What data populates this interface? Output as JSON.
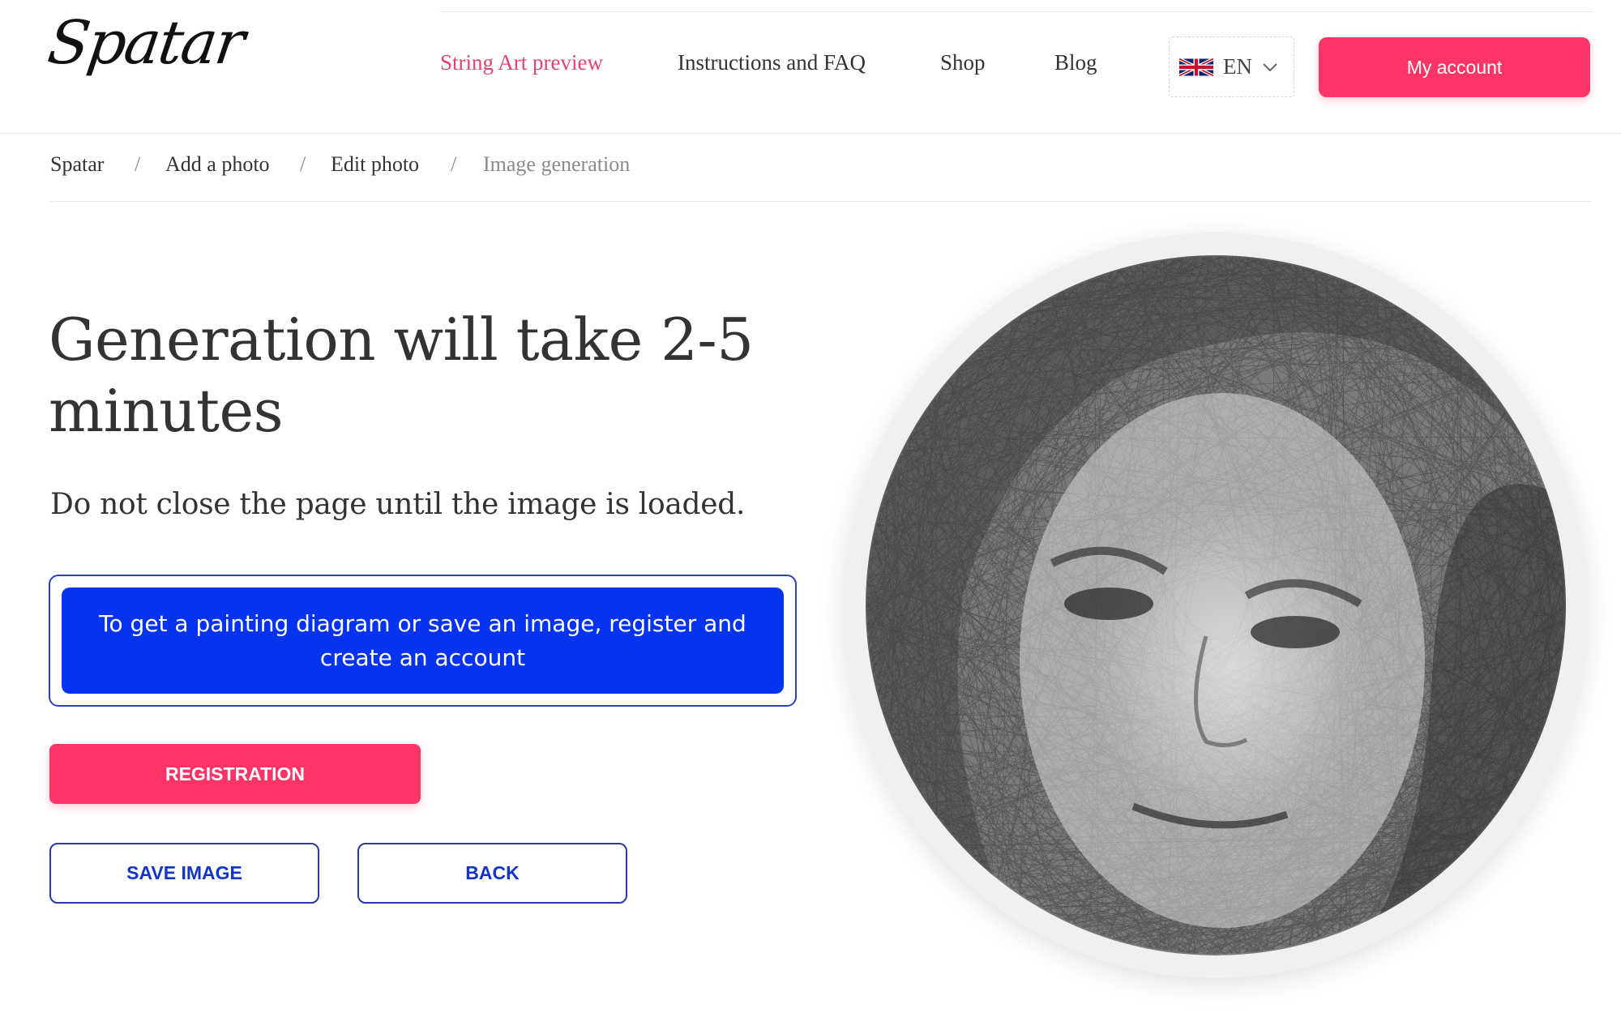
{
  "brand": {
    "logo_text": "Spatar"
  },
  "nav": {
    "items": [
      {
        "label": "String Art preview",
        "active": true
      },
      {
        "label": "Instructions and FAQ",
        "active": false
      },
      {
        "label": "Shop",
        "active": false
      },
      {
        "label": "Blog",
        "active": false
      }
    ]
  },
  "language": {
    "code": "EN",
    "icon": "uk-flag-icon"
  },
  "account_button": "My account",
  "breadcrumb": {
    "items": [
      "Spatar",
      "Add a photo",
      "Edit photo",
      "Image generation"
    ],
    "separator": "/"
  },
  "main": {
    "title": "Generation will take 2-5 minutes",
    "subtitle": "Do not close the page until the image is loaded.",
    "notice": "To get a painting diagram or save an image, register and create an account",
    "registration_button": "REGISTRATION",
    "save_button": "SAVE IMAGE",
    "back_button": "BACK"
  },
  "colors": {
    "accent_pink": "#fb3565",
    "active_nav": "#e0456c",
    "notice_blue": "#0533f0",
    "outline_blue": "#1234c8"
  }
}
